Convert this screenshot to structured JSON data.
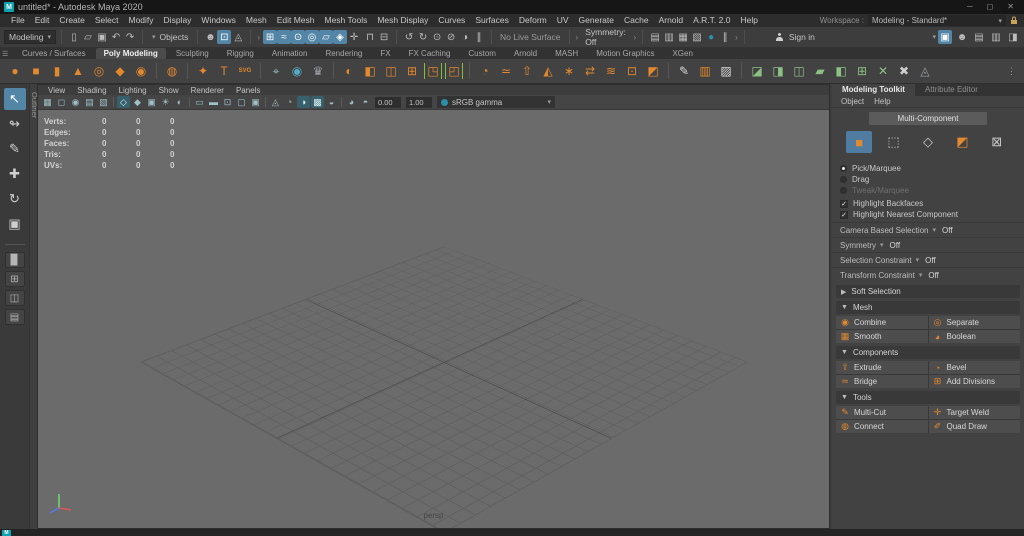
{
  "colors": {
    "accent_blue": "#5285a6",
    "shelf_orange": "#e2882e",
    "maya_teal": "#0fa3b1",
    "boolean_green": "#8cc084"
  },
  "titlebar": {
    "title": "untitled* - Autodesk Maya 2020",
    "logo": "M",
    "minimize": "─",
    "maximize": "◻",
    "close": "✕"
  },
  "menubar": {
    "items": [
      "File",
      "Edit",
      "Create",
      "Select",
      "Modify",
      "Display",
      "Windows",
      "Mesh",
      "Edit Mesh",
      "Mesh Tools",
      "Mesh Display",
      "Curves",
      "Surfaces",
      "Deform",
      "UV",
      "Generate",
      "Cache",
      "Arnold",
      "A.R.T. 2.0",
      "Help"
    ],
    "workspace_label": "Workspace :",
    "workspace_value": "Modeling - Standard*"
  },
  "statusline": {
    "mode": "Modeling",
    "objects_label": "Objects",
    "file_icons": [
      {
        "name": "new-scene-icon",
        "glyph": "▯"
      },
      {
        "name": "open-scene-icon",
        "glyph": "▱"
      },
      {
        "name": "save-scene-icon",
        "glyph": "▣"
      },
      {
        "name": "undo-icon",
        "glyph": "↶"
      },
      {
        "name": "redo-icon",
        "glyph": "↷"
      }
    ],
    "mask_icons": [
      {
        "name": "select-by-hierarchy-icon",
        "glyph": "☻"
      },
      {
        "name": "select-by-object-icon",
        "glyph": "⊡",
        "active": true
      },
      {
        "name": "select-by-component-icon",
        "glyph": "◬"
      }
    ],
    "snap_icons": [
      {
        "name": "snap-to-grid-icon",
        "glyph": "⊞",
        "active": true
      },
      {
        "name": "snap-to-curve-icon",
        "glyph": "≈",
        "active": true
      },
      {
        "name": "snap-to-point-icon",
        "glyph": "⊙",
        "active": true
      },
      {
        "name": "snap-to-projected-center-icon",
        "glyph": "◎",
        "active": true
      },
      {
        "name": "snap-to-view-plane-icon",
        "glyph": "▱",
        "active": true
      },
      {
        "name": "make-live-icon",
        "glyph": "◈",
        "active": true
      },
      {
        "name": "snap-together-icon",
        "glyph": "✛"
      }
    ],
    "lock_icons": [
      {
        "name": "lock-selection-icon",
        "glyph": "⊓"
      },
      {
        "name": "input-output-connections-icon",
        "glyph": "⊟"
      }
    ],
    "history_icons": [
      {
        "name": "construction-history-icon",
        "glyph": "↺"
      },
      {
        "name": "history-toggle-icon",
        "glyph": "↻"
      },
      {
        "name": "input-connections-icon",
        "glyph": "⊙"
      },
      {
        "name": "output-connections-icon",
        "glyph": "⊘"
      },
      {
        "name": "history-mode-icon",
        "glyph": "◑"
      },
      {
        "name": "pause-history-icon",
        "glyph": "∥"
      }
    ],
    "no_live_surface": "No Live Surface",
    "symmetry": "Symmetry: Off",
    "render_icons": [
      {
        "name": "render-current-frame-icon",
        "glyph": "▤"
      },
      {
        "name": "ipr-render-icon",
        "glyph": "▥"
      },
      {
        "name": "render-sequence-icon",
        "glyph": "▦"
      },
      {
        "name": "display-render-settings-icon",
        "glyph": "▧"
      },
      {
        "name": "render-view-icon",
        "glyph": "●",
        "color": "#2a8fa8"
      },
      {
        "name": "pause-viewport-icon",
        "glyph": "∥"
      }
    ],
    "sign_in": "Sign in",
    "right_icons": [
      {
        "name": "modeling-toolkit-toggle",
        "glyph": "▣",
        "active": true
      },
      {
        "name": "character-controls-toggle",
        "glyph": "☻"
      },
      {
        "name": "attribute-editor-toggle",
        "glyph": "▤"
      },
      {
        "name": "tool-settings-toggle",
        "glyph": "▥"
      },
      {
        "name": "channel-box-toggle",
        "glyph": "◨"
      }
    ]
  },
  "shelf": {
    "menu_glyph": "☰",
    "tabs": [
      {
        "label": "Curves / Surfaces"
      },
      {
        "label": "Poly Modeling",
        "active": true
      },
      {
        "label": "Sculpting"
      },
      {
        "label": "Rigging"
      },
      {
        "label": "Animation"
      },
      {
        "label": "Rendering"
      },
      {
        "label": "FX"
      },
      {
        "label": "FX Caching"
      },
      {
        "label": "Custom"
      },
      {
        "label": "Arnold"
      },
      {
        "label": "MASH"
      },
      {
        "label": "Motion Graphics"
      },
      {
        "label": "XGen"
      }
    ],
    "icons": [
      {
        "name": "poly-sphere-icon",
        "glyph": "●",
        "color": "#e2882e"
      },
      {
        "name": "poly-cube-icon",
        "glyph": "■",
        "color": "#e2882e"
      },
      {
        "name": "poly-cylinder-icon",
        "glyph": "▮",
        "color": "#e2882e"
      },
      {
        "name": "poly-cone-icon",
        "glyph": "▲",
        "color": "#e2882e"
      },
      {
        "name": "poly-torus-icon",
        "glyph": "◎",
        "color": "#e2882e"
      },
      {
        "name": "poly-plane-icon",
        "glyph": "◆",
        "color": "#e2882e"
      },
      {
        "name": "poly-disc-icon",
        "glyph": "◉",
        "color": "#e2882e"
      },
      {
        "sep": true
      },
      {
        "name": "platonic-solid-icon",
        "glyph": "◍",
        "color": "#e2882e"
      },
      {
        "sep": true
      },
      {
        "name": "super-shape-icon",
        "glyph": "✦",
        "color": "#e2882e"
      },
      {
        "name": "poly-type-icon",
        "glyph": "T",
        "color": "#e2882e"
      },
      {
        "name": "svg-tool-icon",
        "glyph": "SVG",
        "color": "#e2882e",
        "tiny": true
      },
      {
        "sep": true
      },
      {
        "name": "construction-plane-icon",
        "glyph": "⌖",
        "color": "#8fb7bd"
      },
      {
        "name": "make-live-sphere-icon",
        "glyph": "◉",
        "color": "#57a7c2"
      },
      {
        "name": "curve-warp-icon",
        "glyph": "♛",
        "color": "#9aa0a6"
      },
      {
        "sep": true
      },
      {
        "name": "smooth-icon",
        "glyph": "◐",
        "color": "#e2882e"
      },
      {
        "name": "reduce-icon",
        "glyph": "◧",
        "color": "#e2882e"
      },
      {
        "name": "mirror-icon",
        "glyph": "◫",
        "color": "#e2882e"
      },
      {
        "name": "subdivide-icon",
        "glyph": "⊞",
        "color": "#e2882e"
      },
      {
        "name": "crease-tool-icon",
        "glyph": "◳",
        "color": "#e2882e",
        "bracket": true
      },
      {
        "name": "spin-edge-icon",
        "glyph": "◰",
        "color": "#e2882e",
        "bracket": true
      },
      {
        "sep": true
      },
      {
        "name": "bevel-icon",
        "glyph": "◔",
        "color": "#e2882e"
      },
      {
        "name": "bridge-icon",
        "glyph": "≃",
        "color": "#e2882e"
      },
      {
        "name": "extrude-icon",
        "glyph": "⇧",
        "color": "#e2882e"
      },
      {
        "name": "wedge-icon",
        "glyph": "◭",
        "color": "#e2882e"
      },
      {
        "name": "poke-icon",
        "glyph": "∗",
        "color": "#e2882e"
      },
      {
        "name": "symmetrize-icon",
        "glyph": "⇄",
        "color": "#e2882e"
      },
      {
        "name": "average-vertices-icon",
        "glyph": "≋",
        "color": "#e2882e"
      },
      {
        "name": "transfer-attributes-icon",
        "glyph": "⊡",
        "color": "#e2882e"
      },
      {
        "name": "sculpt-tool-icon",
        "glyph": "◩",
        "color": "#e2882e"
      },
      {
        "sep": true
      },
      {
        "name": "multi-cut-icon",
        "glyph": "✎",
        "color": "#d8d8d8"
      },
      {
        "name": "insert-edge-loop-icon",
        "glyph": "▥",
        "color": "#e2882e"
      },
      {
        "name": "offset-edge-loop-icon",
        "glyph": "▨",
        "color": "#d8d8d8"
      },
      {
        "sep": true
      },
      {
        "name": "boolean-union-icon",
        "glyph": "◪",
        "color": "#8cc084"
      },
      {
        "name": "boolean-difference-icon",
        "glyph": "◨",
        "color": "#8cc084"
      },
      {
        "name": "boolean-intersection-icon",
        "glyph": "◫",
        "color": "#8cc084"
      },
      {
        "name": "combine-icon",
        "glyph": "▰",
        "color": "#8cc084"
      },
      {
        "name": "separate-icon",
        "glyph": "◧",
        "color": "#8cc084"
      },
      {
        "name": "extract-icon",
        "glyph": "⊞",
        "color": "#8cc084"
      },
      {
        "name": "cut-faces-icon",
        "glyph": "✕",
        "color": "#8cc084"
      },
      {
        "name": "delete-edge-icon",
        "glyph": "✖",
        "color": "#cfcfcf"
      },
      {
        "name": "remesh-icon",
        "glyph": "◬",
        "color": "#9aa0a6"
      }
    ]
  },
  "toolbox": {
    "tools": [
      {
        "name": "select-tool",
        "glyph": "↖",
        "active": true
      },
      {
        "name": "lasso-select-tool",
        "glyph": "↬"
      },
      {
        "name": "paint-select-tool",
        "glyph": "✎"
      },
      {
        "name": "move-tool",
        "glyph": "✚"
      },
      {
        "name": "rotate-tool",
        "glyph": "↻"
      },
      {
        "name": "scale-tool",
        "glyph": "▣"
      }
    ],
    "layouts": [
      {
        "name": "layout-single-pane",
        "glyph": "▉"
      },
      {
        "name": "layout-four-pane",
        "glyph": "⊞"
      },
      {
        "name": "layout-persp-outliner",
        "glyph": "◫"
      },
      {
        "name": "layout-persp-graph",
        "glyph": "▤"
      }
    ],
    "outliner_label": "Outliner"
  },
  "viewport": {
    "menus": [
      "View",
      "Shading",
      "Lighting",
      "Show",
      "Renderer",
      "Panels"
    ],
    "toolbar_icons": [
      {
        "name": "select-camera-icon",
        "glyph": "▦"
      },
      {
        "name": "lock-camera-icon",
        "glyph": "◻"
      },
      {
        "name": "camera-attributes-icon",
        "glyph": "◉"
      },
      {
        "name": "bookmarks-icon",
        "glyph": "▤"
      },
      {
        "name": "image-plane-icon",
        "glyph": "▧"
      },
      {
        "sep": true
      },
      {
        "name": "wireframe-mode-icon",
        "glyph": "◇",
        "active": true
      },
      {
        "name": "shaded-mode-icon",
        "glyph": "◆"
      },
      {
        "name": "textured-mode-icon",
        "glyph": "▣"
      },
      {
        "name": "use-all-lights-icon",
        "glyph": "☀"
      },
      {
        "name": "shadows-icon",
        "glyph": "◐"
      },
      {
        "sep": true
      },
      {
        "name": "resolution-gate-icon",
        "glyph": "▭"
      },
      {
        "name": "gate-mask-icon",
        "glyph": "▬"
      },
      {
        "name": "field-chart-icon",
        "glyph": "⊡"
      },
      {
        "name": "safe-action-icon",
        "glyph": "▢"
      },
      {
        "name": "safe-title-icon",
        "glyph": "▣"
      },
      {
        "sep": true
      },
      {
        "name": "isolate-select-icon",
        "glyph": "◬"
      },
      {
        "name": "xray-icon",
        "glyph": "◔"
      },
      {
        "name": "ambient-occlusion-icon",
        "glyph": "◑",
        "active": true
      },
      {
        "name": "anti-aliasing-icon",
        "glyph": "▩",
        "active": true
      },
      {
        "name": "motion-blur-icon",
        "glyph": "◒"
      },
      {
        "sep": true
      },
      {
        "name": "exposure-icon",
        "glyph": "◕"
      },
      {
        "name": "gamma-icon",
        "glyph": "◓"
      }
    ],
    "exposure": "0.00",
    "gamma": "1.00",
    "colorspace": "sRGB gamma",
    "hud_rows": [
      {
        "label": "Verts:",
        "v1": "0",
        "v2": "0",
        "v3": "0"
      },
      {
        "label": "Edges:",
        "v1": "0",
        "v2": "0",
        "v3": "0"
      },
      {
        "label": "Faces:",
        "v1": "0",
        "v2": "0",
        "v3": "0"
      },
      {
        "label": "Tris:",
        "v1": "0",
        "v2": "0",
        "v3": "0"
      },
      {
        "label": "UVs:",
        "v1": "0",
        "v2": "0",
        "v3": "0"
      }
    ],
    "camera_label": "persp"
  },
  "panel": {
    "tabs": [
      {
        "label": "Modeling Toolkit",
        "active": true
      },
      {
        "label": "Attribute Editor"
      }
    ],
    "menus": [
      "Object",
      "Help"
    ],
    "multi_component": "Multi-Component",
    "component_modes": [
      {
        "name": "object-mode-icon",
        "glyph": "■",
        "color": "#e2882e",
        "active": true
      },
      {
        "name": "vertex-mode-icon",
        "glyph": "⬚",
        "color": "#c9c9c9"
      },
      {
        "name": "edge-mode-icon",
        "glyph": "◇",
        "color": "#c9c9c9"
      },
      {
        "name": "face-mode-icon",
        "glyph": "◩",
        "color": "#e2882e"
      },
      {
        "name": "uv-mode-icon",
        "glyph": "⊠",
        "color": "#c9c9c9"
      }
    ],
    "radios": [
      {
        "label": "Pick/Marquee",
        "selected": true
      },
      {
        "label": "Drag"
      },
      {
        "label": "Tweak/Marquee",
        "disabled": true
      }
    ],
    "checks": [
      {
        "label": "Highlight Backfaces",
        "checked": true
      },
      {
        "label": "Highlight Nearest Component",
        "checked": true
      }
    ],
    "dropdown_rows": [
      {
        "label": "Camera Based Selection",
        "value": "Off"
      },
      {
        "label": "Symmetry",
        "value": "Off"
      },
      {
        "label": "Selection Constraint",
        "value": "Off"
      },
      {
        "label": "Transform Constraint",
        "value": "Off"
      }
    ],
    "soft_selection": "Soft Selection",
    "sections": [
      {
        "title": "Mesh",
        "buttons": [
          {
            "label": "Combine",
            "icon": "◉"
          },
          {
            "label": "Separate",
            "icon": "◎"
          },
          {
            "label": "Smooth",
            "icon": "▦"
          },
          {
            "label": "Boolean",
            "icon": "◕"
          }
        ]
      },
      {
        "title": "Components",
        "buttons": [
          {
            "label": "Extrude",
            "icon": "⇧"
          },
          {
            "label": "Bevel",
            "icon": "◔"
          },
          {
            "label": "Bridge",
            "icon": "≃"
          },
          {
            "label": "Add Divisions",
            "icon": "⊞"
          }
        ]
      },
      {
        "title": "Tools",
        "buttons": [
          {
            "label": "Multi-Cut",
            "icon": "✎"
          },
          {
            "label": "Target Weld",
            "icon": "✛"
          },
          {
            "label": "Connect",
            "icon": "◍"
          },
          {
            "label": "Quad Draw",
            "icon": "✐"
          }
        ]
      }
    ]
  }
}
